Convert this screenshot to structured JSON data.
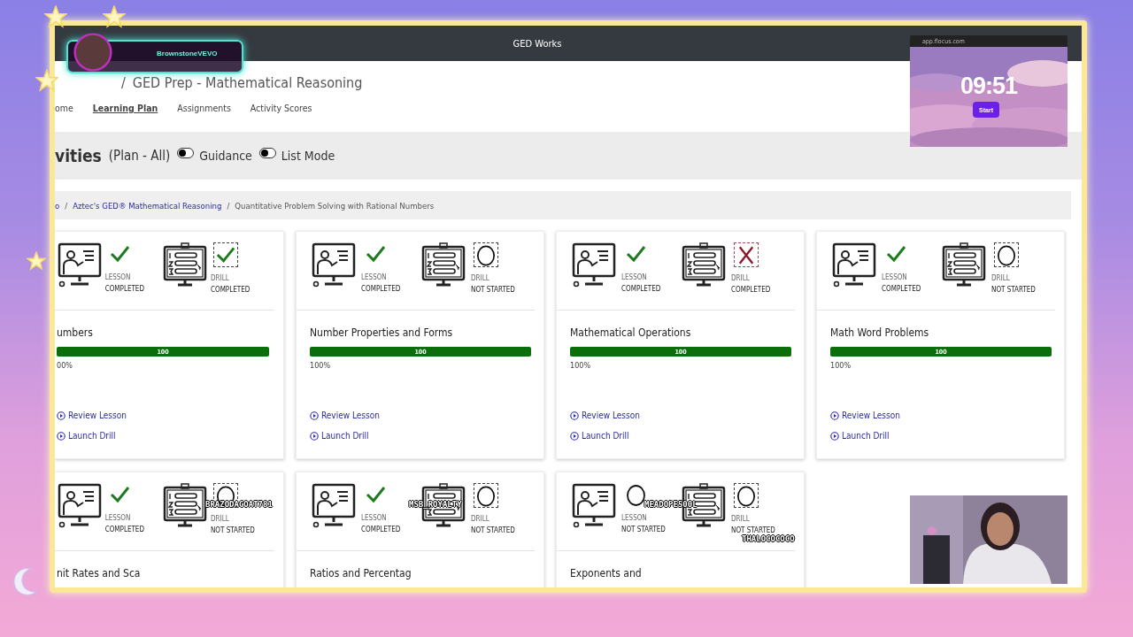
{
  "overlay_user": {
    "name": "BrownstoneVEVO"
  },
  "browser": {
    "navbar_title": "GED Works",
    "title_separator": "/",
    "page_title": "GED Prep - Mathematical Reasoning",
    "nav": [
      {
        "label": "ome",
        "selected": false
      },
      {
        "label": "Learning Plan",
        "selected": true
      },
      {
        "label": "Assignments",
        "selected": false
      },
      {
        "label": "Activity Scores",
        "selected": false
      }
    ],
    "heading": "vities",
    "heading_sub": "(Plan - All)",
    "toggles": [
      {
        "label": "Guidance",
        "on": false
      },
      {
        "label": "List Mode",
        "on": false
      }
    ],
    "breadcrumb": [
      {
        "label": "o",
        "kind": "link"
      },
      {
        "label": "Aztec's GED® Mathematical Reasoning",
        "kind": "link",
        "separator": "/"
      },
      {
        "label": "Quantitative Problem Solving with Rational Numbers",
        "kind": "current",
        "separator": "/"
      }
    ],
    "cards": [
      {
        "lesson": {
          "completed": true,
          "label": "LESSON",
          "state": "COMPLETED"
        },
        "drill": {
          "completed": true,
          "passed": true,
          "label": "DRILL",
          "state": "COMPLETED"
        },
        "title": "umbers",
        "progress": {
          "level": 1,
          "label": "100"
        },
        "percent": "00%",
        "links": [
          "Review Lesson",
          "Launch Drill"
        ]
      },
      {
        "lesson": {
          "completed": true,
          "label": "LESSON",
          "state": "COMPLETED"
        },
        "drill": {
          "completed": false,
          "label": "DRILL",
          "state": "NOT STARTED"
        },
        "title": "Number Properties and Forms",
        "progress": {
          "level": 1,
          "label": "100"
        },
        "percent": "100%",
        "links": [
          "Review Lesson",
          "Launch Drill"
        ]
      },
      {
        "lesson": {
          "completed": true,
          "label": "LESSON",
          "state": "COMPLETED"
        },
        "drill": {
          "completed": true,
          "passed": false,
          "label": "DRILL",
          "state": "COMPLETED"
        },
        "title": "Mathematical Operations",
        "progress": {
          "level": 1,
          "label": "100"
        },
        "percent": "100%",
        "links": [
          "Review Lesson",
          "Launch Drill"
        ]
      },
      {
        "lesson": {
          "completed": true,
          "label": "LESSON",
          "state": "COMPLETED"
        },
        "drill": {
          "completed": false,
          "label": "DRILL",
          "state": "NOT STARTED"
        },
        "title": "Math Word Problems",
        "progress": {
          "level": 1,
          "label": "100"
        },
        "percent": "100%",
        "links": [
          "Review Lesson",
          "Launch Drill"
        ]
      },
      {
        "lesson": {
          "completed": true,
          "label": "LESSON",
          "state": "COMPLETED"
        },
        "drill": {
          "completed": false,
          "label": "DRILL",
          "state": "NOT STARTED"
        },
        "title": "nit Rates and Sca"
      },
      {
        "lesson": {
          "completed": true,
          "label": "LESSON",
          "state": "COMPLETED"
        },
        "drill": {
          "completed": false,
          "label": "DRILL",
          "state": "NOT STARTED"
        },
        "title": "Ratios and Percentag"
      },
      {
        "lesson": {
          "completed": false,
          "label": "LESSON",
          "state": "NOT STARTED"
        },
        "drill": {
          "completed": false,
          "label": "DRILL",
          "state": "NOT STARTED"
        },
        "title": "Exponents and"
      }
    ]
  },
  "timer": {
    "url": "app.flocus.com",
    "time": "09:51",
    "button": "Start"
  },
  "chat_names": [
    "BRAZODAGOAT781",
    "MSB_ROYALTY",
    "MEADOPE500L",
    "THALOCOCOCO"
  ]
}
